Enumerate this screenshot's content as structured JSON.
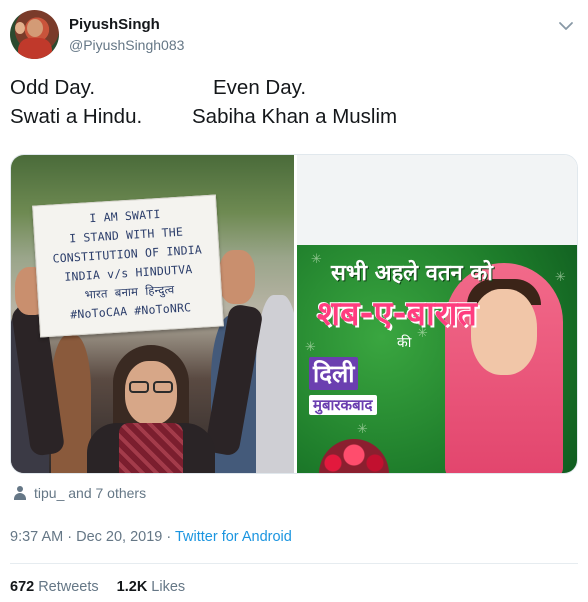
{
  "author": {
    "display_name": "PiyushSingh",
    "handle": "@PiyushSingh083"
  },
  "tweet": {
    "lines": [
      {
        "left": "Odd Day.",
        "right": "Even Day."
      },
      {
        "left": "Swati a Hindu.",
        "right": "Sabiha Khan a Muslim"
      }
    ]
  },
  "media": {
    "left_photo": {
      "sign_lines": [
        "I AM SWATI",
        "I STAND WITH THE",
        "CONSTITUTION OF INDIA",
        "INDIA v/s HINDUTVA",
        "भारत बनाम हिन्दुत्व",
        "#NoToCAA  #NoToNRC"
      ]
    },
    "right_photo": {
      "headline": "सभी अहले वतन को",
      "title": "शब-ए-बारात",
      "ki": "की",
      "dili": "दिली",
      "mubarakbad": "मुबारकबाद"
    }
  },
  "retweeted_by": "tipu_ and 7 others",
  "meta": {
    "time": "9:37 AM",
    "date": "Dec 20, 2019",
    "separator": " · ",
    "source": "Twitter for Android"
  },
  "stats": {
    "retweets_count": "672",
    "retweets_label": "Retweets",
    "likes_count": "1.2K",
    "likes_label": "Likes"
  },
  "icons": {
    "chevron": "chevron-down-icon",
    "retweeted_by": "person-icon"
  },
  "colors": {
    "link": "#1b95e0",
    "muted": "#657786",
    "text": "#14171a"
  }
}
